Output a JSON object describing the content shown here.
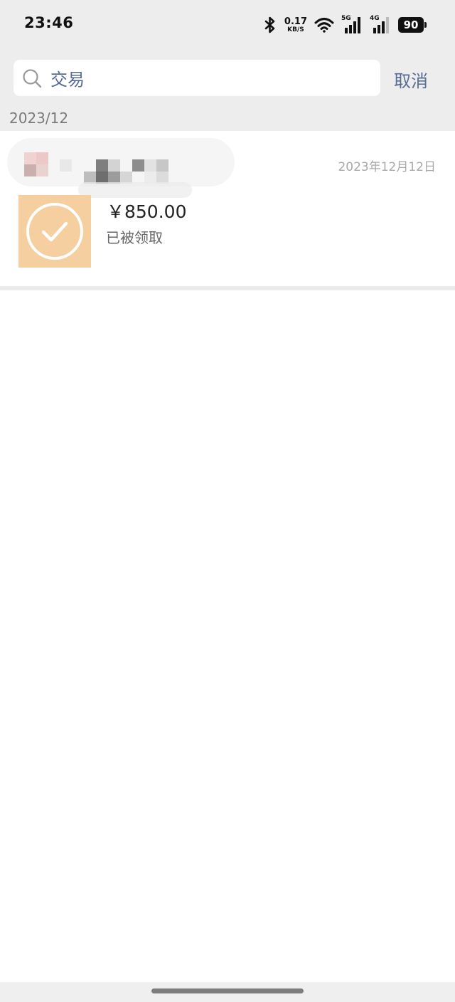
{
  "status_bar": {
    "time": "23:46",
    "net_speed_value": "0.17",
    "net_speed_unit": "KB/S",
    "network_5g": "5G",
    "network_4g": "4G",
    "battery": "90",
    "icons": [
      "bluetooth-icon",
      "wifi-icon",
      "signal-icon",
      "battery-icon"
    ]
  },
  "search": {
    "value": "交易",
    "placeholder": "",
    "cancel_label": "取消",
    "icon": "search-icon"
  },
  "month_header": "2023/12",
  "transactions": [
    {
      "date": "2023年12月12日",
      "amount": "￥850.00",
      "status": "已被领取",
      "icon": "check-circle-icon"
    }
  ],
  "colors": {
    "link_blue": "#576b95",
    "tile_orange": "#f5cf9f",
    "header_bg": "#ededed"
  }
}
